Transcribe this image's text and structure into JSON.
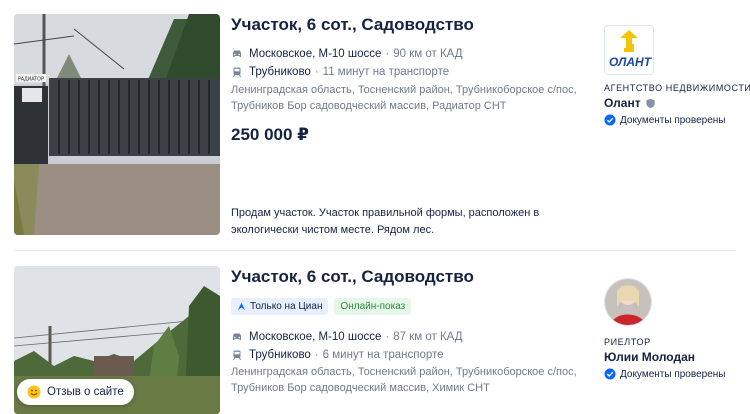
{
  "listings": [
    {
      "title": "Участок, 6 сот., Садоводство",
      "highway": {
        "name": "Московское, М-10 шоссе",
        "distance": "90 км от КАД",
        "icon": "car-icon"
      },
      "station": {
        "name": "Трубниково",
        "distance": "11 минут на транспорте",
        "icon": "train-icon"
      },
      "address": "Ленинградская область, Тосненский район, Трубникоборское с/пос, Трубников Бор садоводческий массив, Радиатор СНТ",
      "price": "250 000 ₽",
      "description": "Продам участок. Участок правильной формы, расположен в экологически чистом месте. Рядом лес.",
      "photo_sign": "РАДИАТОР",
      "agent": {
        "logo_text": "ОЛАНТ",
        "type": "АГЕНТСТВО НЕДВИЖИМОСТИ",
        "name": "Олант",
        "verified": "Документы проверены"
      }
    },
    {
      "title": "Участок, 6 сот., Садоводство",
      "badges": [
        "Только на Циан",
        "Онлайн-показ"
      ],
      "highway": {
        "name": "Московское, М-10 шоссе",
        "distance": "87 км от КАД",
        "icon": "car-icon"
      },
      "station": {
        "name": "Трубниково",
        "distance": "6 минут на транспорте",
        "icon": "train-icon"
      },
      "address": "Ленинградская область, Тосненский район, Трубникоборское с/пос, Трубников Бор садоводческий массив, Химик СНТ",
      "agent": {
        "type": "РИЕЛТОР",
        "name": "Юлии Молодан",
        "verified": "Документы проверены"
      }
    }
  ],
  "review_button": "Отзыв о сайте",
  "colors": {
    "text": "#152242",
    "secondary": "#707a8c",
    "accent": "#0468ff",
    "online_badge": "#2b8a3e"
  }
}
